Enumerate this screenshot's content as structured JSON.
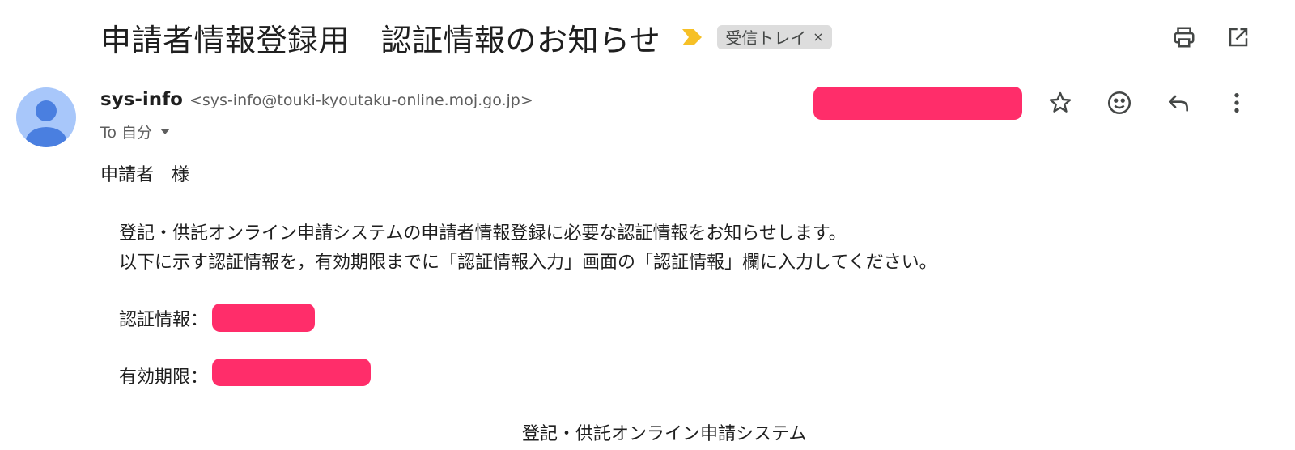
{
  "subject": "申請者情報登録用　認証情報のお知らせ",
  "label_chip": {
    "label": "受信トレイ",
    "close": "×"
  },
  "toolbar_icons": [
    "print-icon",
    "open-in-new-window-icon"
  ],
  "sender": {
    "name": "sys-info",
    "email": "<sys-info@touki-kyoutaku-online.moj.go.jp>",
    "recipient": "To 自分"
  },
  "message_actions": [
    "star-icon",
    "emoji-reaction-icon",
    "reply-icon",
    "more-options-icon"
  ],
  "colors": {
    "avatar_bg": "#a8c7fa",
    "avatar_fg": "#4a7fe0",
    "importance": "#f6c026",
    "redaction": "#ff2d6a",
    "chip_bg": "#dddddd"
  },
  "body": {
    "greeting": "申請者　様",
    "line1": "登記・供託オンライン申請システムの申請者情報登録に必要な認証情報をお知らせします。",
    "line2": "以下に示す認証情報を，有効期限までに「認証情報入力」画面の「認証情報」欄に入力してください。",
    "auth_label": "認証情報：",
    "expiry_label": "有効期限：",
    "signature": "登記・供託オンライン申請システム"
  }
}
